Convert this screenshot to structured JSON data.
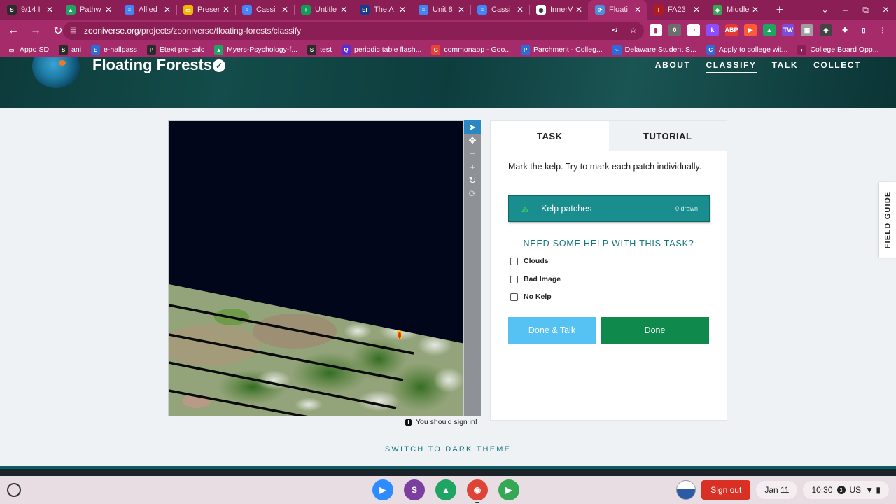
{
  "browser": {
    "tabs": [
      {
        "title": "9/14 I",
        "icon_bg": "#2b2b2b",
        "glyph": "S"
      },
      {
        "title": "Pathw",
        "icon_bg": "#1fa463",
        "glyph": "▲"
      },
      {
        "title": "Allied",
        "icon_bg": "#4285f4",
        "glyph": "≡"
      },
      {
        "title": "Preser",
        "icon_bg": "#f4b400",
        "glyph": "▭"
      },
      {
        "title": "Cassi",
        "icon_bg": "#4285f4",
        "glyph": "≡"
      },
      {
        "title": "Untitle",
        "icon_bg": "#0f9d58",
        "glyph": "+"
      },
      {
        "title": "The A",
        "icon_bg": "#1a3c8c",
        "glyph": "EI"
      },
      {
        "title": "Unit 8",
        "icon_bg": "#4285f4",
        "glyph": "≡"
      },
      {
        "title": "Cassi",
        "icon_bg": "#4285f4",
        "glyph": "≡"
      },
      {
        "title": "InnerV",
        "icon_bg": "#ffffff",
        "glyph": "◉"
      },
      {
        "title": "Floati",
        "icon_bg": "#4a90d9",
        "glyph": "⟳",
        "active": true
      },
      {
        "title": "FA23",
        "icon_bg": "#b31b1b",
        "glyph": "T"
      },
      {
        "title": "Middle",
        "icon_bg": "#34a853",
        "glyph": "◆"
      }
    ],
    "new_tab_glyph": "+",
    "window_controls": [
      "⌄",
      "–",
      "⧉",
      "✕"
    ],
    "url_host": "zooniverse.org",
    "url_path": "/projects/zooniverse/floating-forests/classify",
    "extensions": [
      {
        "glyph": "▮",
        "bg": "#ffffff"
      },
      {
        "glyph": "0",
        "bg": "#6d6d6d"
      },
      {
        "glyph": "◔",
        "bg": "#ffffff"
      },
      {
        "glyph": "k",
        "bg": "#8b4dff"
      },
      {
        "glyph": "ABP",
        "bg": "#e53935"
      },
      {
        "glyph": "▶",
        "bg": "#ff5a36"
      },
      {
        "glyph": "▲",
        "bg": "#1fa463"
      },
      {
        "glyph": "TW",
        "bg": "#7b4dd8"
      },
      {
        "glyph": "▦",
        "bg": "#9e9e9e"
      },
      {
        "glyph": "◈",
        "bg": "#444444"
      },
      {
        "glyph": "✚",
        "bg": "#a62b6b"
      },
      {
        "glyph": "▯",
        "bg": "#a62b6b"
      },
      {
        "glyph": "⋮",
        "bg": "#a62b6b"
      }
    ],
    "bookmarks": [
      {
        "label": "Appo SD",
        "icon_bg": "#a62b6b",
        "glyph": "▭"
      },
      {
        "label": "ani",
        "icon_bg": "#2b2b2b",
        "glyph": "S"
      },
      {
        "label": "e-hallpass",
        "icon_bg": "#2d6bd6",
        "glyph": "E"
      },
      {
        "label": "Etext pre-calc",
        "icon_bg": "#2b2b2b",
        "glyph": "P"
      },
      {
        "label": "Myers-Psychology-f...",
        "icon_bg": "#1fa463",
        "glyph": "▲"
      },
      {
        "label": "test",
        "icon_bg": "#2b2b2b",
        "glyph": "S"
      },
      {
        "label": "periodic table flash...",
        "icon_bg": "#5a2bd8",
        "glyph": "Q"
      },
      {
        "label": "commonapp - Goo...",
        "icon_bg": "#ea4335",
        "glyph": "G"
      },
      {
        "label": "Parchment - Colleg...",
        "icon_bg": "#2d6bd6",
        "glyph": "P"
      },
      {
        "label": "Delaware Student S...",
        "icon_bg": "#2d6bd6",
        "glyph": "⌁"
      },
      {
        "label": "Apply to college wit...",
        "icon_bg": "#2d6bd6",
        "glyph": "C"
      },
      {
        "label": "College Board Opp...",
        "icon_bg": "#8b1e54",
        "glyph": "◐"
      }
    ]
  },
  "site": {
    "project_title": "Floating Forests",
    "nav": [
      {
        "label": "ABOUT"
      },
      {
        "label": "CLASSIFY",
        "active": true
      },
      {
        "label": "TALK"
      },
      {
        "label": "COLLECT"
      }
    ]
  },
  "viewer": {
    "tools": [
      "➤",
      "✥",
      "−",
      "+",
      "↻",
      "⟳"
    ],
    "signin_note": "You should sign in!"
  },
  "task": {
    "tabs": [
      "TASK",
      "TUTORIAL"
    ],
    "instruction": "Mark the kelp. Try to mark each patch individually.",
    "tool_label": "Kelp patches",
    "tool_count": "0 drawn",
    "help_link": "NEED SOME HELP WITH THIS TASK?",
    "checkboxes": [
      "Clouds",
      "Bad Image",
      "No Kelp"
    ],
    "done_talk": "Done & Talk",
    "done": "Done"
  },
  "field_guide": "FIELD GUIDE",
  "dark_theme_link": "SWITCH TO DARK THEME",
  "shelf": {
    "apps": [
      {
        "glyph": "▶",
        "bg": "#2d8cff"
      },
      {
        "glyph": "S",
        "bg": "#7b3fa0"
      },
      {
        "glyph": "▲",
        "bg": "#1fa463"
      },
      {
        "glyph": "◉",
        "bg": "#db4437"
      },
      {
        "glyph": "▶",
        "bg": "#34a853"
      }
    ],
    "signout": "Sign out",
    "date": "Jan 11",
    "time": "10:30",
    "badge": "3",
    "locale": "US",
    "status_icons": "▼ ▮"
  }
}
